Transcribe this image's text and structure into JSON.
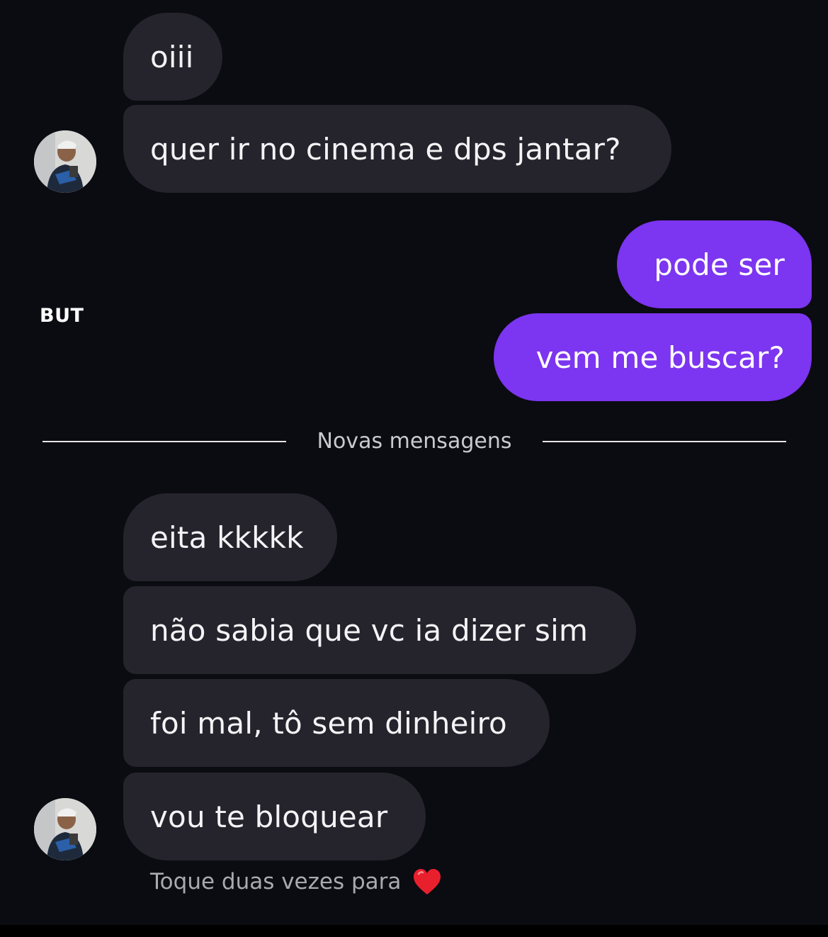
{
  "chat": {
    "messages_first": [
      "oiii",
      "quer ir no cinema e dps jantar?"
    ],
    "sent": [
      "pode ser",
      "vem me buscar?"
    ],
    "divider_label": "Novas mensagens",
    "messages_second": [
      "eita kkkkk",
      "não sabia que vc ia dizer sim",
      "foi mal, tô sem dinheiro",
      "vou te bloquear"
    ],
    "hint": "Toque duas vezes para"
  },
  "overlay": {
    "side_label": "BUT"
  },
  "colors": {
    "background": "#0b0b12",
    "received_bubble": "#25242c",
    "sent_bubble": "#7c35f0",
    "heart": "#e8202e"
  },
  "icons": {
    "heart": "heart-icon",
    "avatar": "avatar"
  }
}
